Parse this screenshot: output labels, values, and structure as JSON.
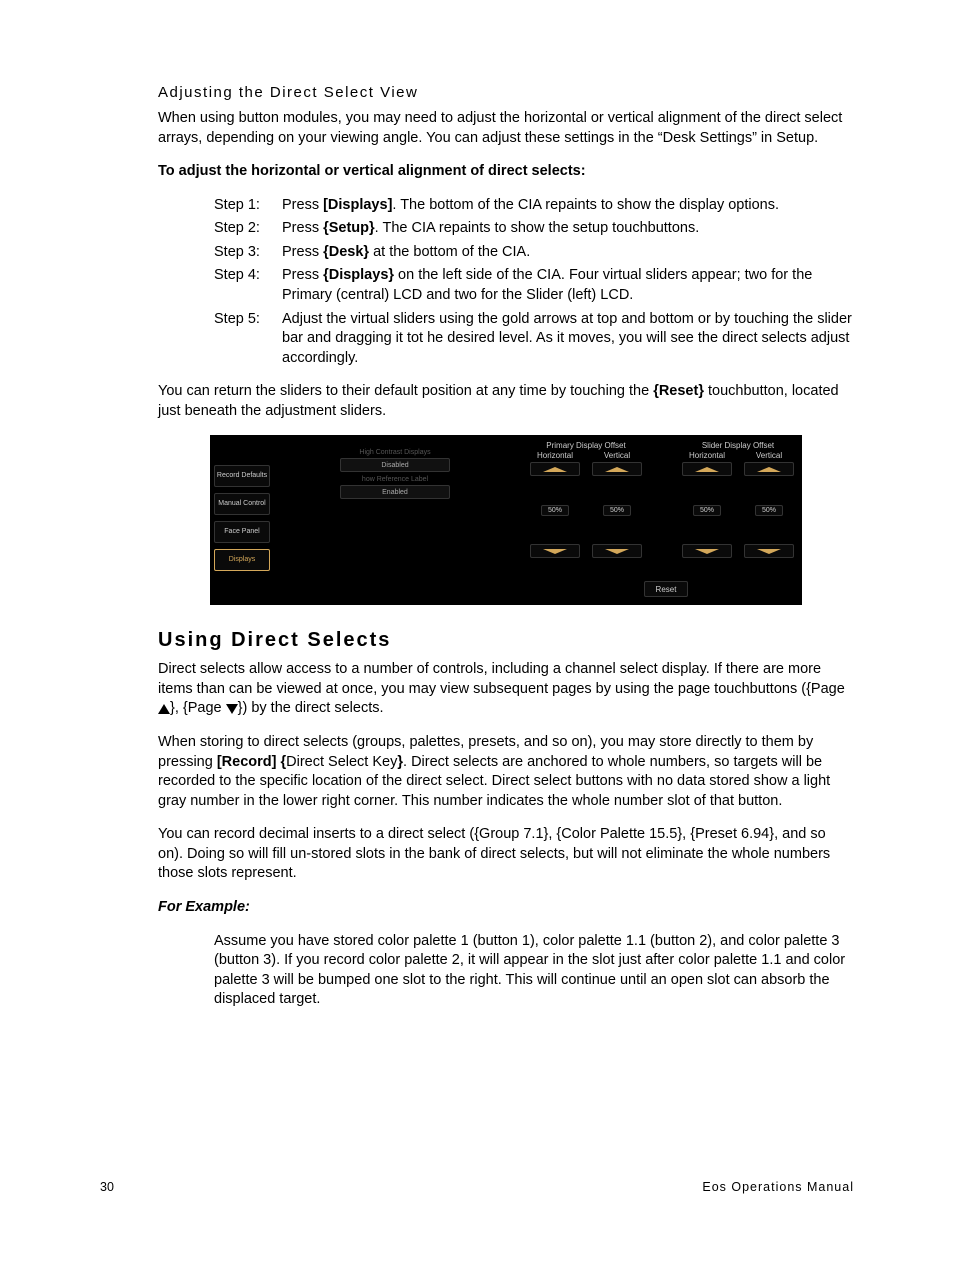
{
  "sec1": {
    "title": "Adjusting the Direct Select View",
    "intro": "When using button modules, you may need to adjust the horizontal or vertical alignment of the direct select arrays, depending on your viewing angle. You can adjust these settings in the “Desk Settings” in Setup.",
    "procHeading": "To adjust the horizontal or vertical alignment of direct selects:",
    "steps": [
      {
        "label": "Step 1:",
        "pre": "Press ",
        "bold": "[Displays]",
        "post": ". The bottom of the CIA repaints to show the display options."
      },
      {
        "label": "Step 2:",
        "pre": "Press ",
        "bold": "{Setup}",
        "post": ". The CIA repaints to show the setup touchbuttons."
      },
      {
        "label": "Step 3:",
        "pre": "Press ",
        "bold": "{Desk}",
        "post": " at the bottom of the CIA."
      },
      {
        "label": "Step 4:",
        "pre": "Press ",
        "bold": "{Displays}",
        "post": " on the left side of the CIA. Four virtual sliders appear; two for the Primary (central) LCD and two for the Slider (left) LCD."
      },
      {
        "label": "Step 5:",
        "pre": "",
        "bold": "",
        "post": "Adjust the virtual sliders using the gold arrows at top and bottom or by touching the slider bar and dragging it tot he desired level. As it moves, you will see the direct selects adjust accordingly."
      }
    ],
    "outro_pre": "You can return the sliders to their default position at any time by touching the ",
    "outro_bold": "{Reset}",
    "outro_post": " touchbutton, located just beneath the adjustment sliders."
  },
  "figure": {
    "sidebar": [
      "Record Defaults",
      "Manual Control",
      "Face Panel",
      "Displays"
    ],
    "mid": {
      "h1": "High Contrast Displays",
      "b1": "Disabled",
      "h2": "how Reference Label",
      "b2": "Enabled"
    },
    "groups": [
      {
        "title": "Primary Display Offset",
        "cols": [
          {
            "axis": "Horizontal",
            "val": "50%"
          },
          {
            "axis": "Vertical",
            "val": "50%"
          }
        ]
      },
      {
        "title": "Slider Display Offset",
        "cols": [
          {
            "axis": "Horizontal",
            "val": "50%"
          },
          {
            "axis": "Vertical",
            "val": "50%"
          }
        ]
      }
    ],
    "reset": "Reset"
  },
  "sec2": {
    "title": "Using Direct Selects",
    "p1_a": "Direct selects allow access to a number of controls, including a channel select display. If there are more items than can be viewed at once, you may view subsequent pages by using the page touchbuttons ({Page ",
    "p1_b": "}, {Page ",
    "p1_c": "}) by the direct selects.",
    "p2_a": "When storing to direct selects (groups, palettes, presets, and so on), you may store directly to them by pressing ",
    "p2_b1": "[Record] {",
    "p2_mid": "Direct Select Key",
    "p2_b2": "}",
    "p2_c": ". Direct selects are anchored to whole numbers, so targets will be recorded to the specific location of the direct select. Direct select buttons with no data stored show a light gray number in the lower right corner. This number indicates the whole number slot of that button.",
    "p3": "You can record decimal inserts to a direct select ({Group 7.1}, {Color Palette 15.5}, {Preset 6.94}, and so on). Doing so will fill un-stored slots in the bank of direct selects, but will not eliminate the whole numbers those slots represent.",
    "exHead": "For Example:",
    "exBody": "Assume you have stored color palette 1 (button 1), color palette 1.1 (button 2), and color palette 3 (button 3). If you record color palette 2, it will appear in the slot just after color palette 1.1 and color palette 3 will be bumped one slot to the right. This will continue until an open slot can absorb the displaced target."
  },
  "footer": {
    "page": "30",
    "title": "Eos Operations Manual"
  }
}
